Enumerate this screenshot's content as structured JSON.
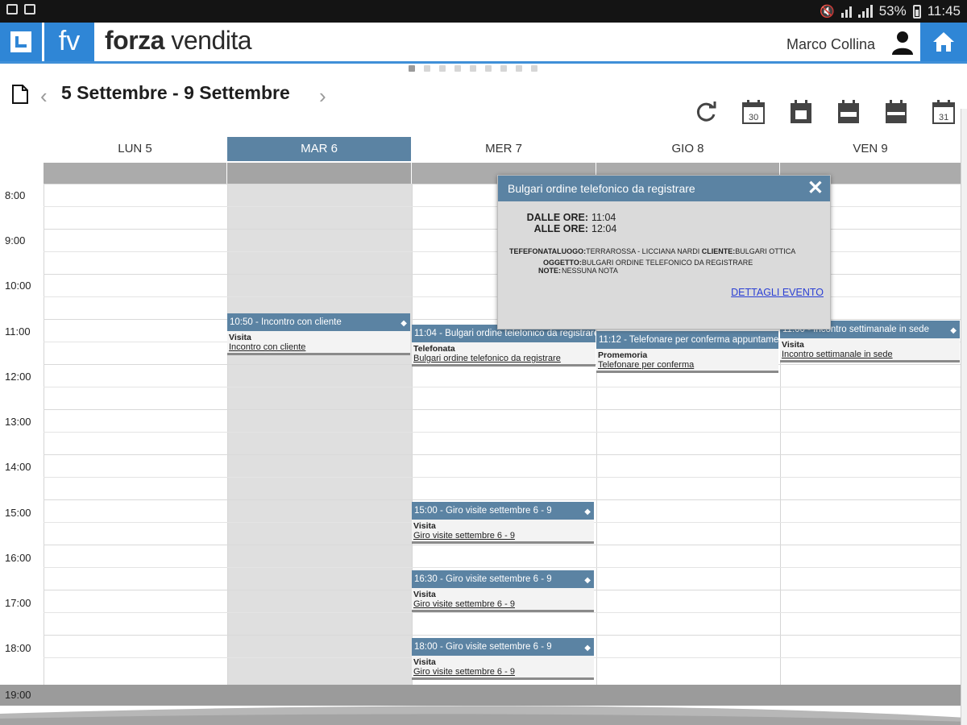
{
  "status_bar": {
    "battery": "53%",
    "time": "11:45"
  },
  "app": {
    "logo_short": "fv",
    "brand_bold": "forza",
    "brand_light": "vendita",
    "user_name": "Marco Collina"
  },
  "nav": {
    "week_title": "5 Settembre - 9 Settembre",
    "prev_arrow": "‹",
    "next_arrow": "›"
  },
  "days": [
    {
      "label": "LUN 5",
      "today": false
    },
    {
      "label": "MAR 6",
      "today": true
    },
    {
      "label": "MER 7",
      "today": false
    },
    {
      "label": "GIO 8",
      "today": false
    },
    {
      "label": "VEN 9",
      "today": false
    }
  ],
  "hours": [
    "8:00",
    "9:00",
    "10:00",
    "11:00",
    "12:00",
    "13:00",
    "14:00",
    "15:00",
    "16:00",
    "17:00",
    "18:00",
    "19:00"
  ],
  "events": [
    {
      "header": "10:50 - Incontro con cliente",
      "type": "Visita",
      "desc": "Incontro con cliente"
    },
    {
      "header": "11:04 - Bulgari ordine telefonico da registrare",
      "type": "Telefonata",
      "desc": "Bulgari ordine telefonico da registrare"
    },
    {
      "header": "11:12 - Telefonare per conferma appuntamento",
      "type": "Promemoria",
      "desc": "Telefonare per conferma"
    },
    {
      "header": "11:00 - Incontro settimanale in sede",
      "type": "Visita",
      "desc": "Incontro settimanale in sede"
    },
    {
      "header": "15:00 - Giro visite settembre 6 - 9",
      "type": "Visita",
      "desc": "Giro visite settembre 6 - 9"
    },
    {
      "header": "16:30 - Giro visite settembre 6 - 9",
      "type": "Visita",
      "desc": "Giro visite settembre 6 - 9"
    },
    {
      "header": "18:00 - Giro visite settembre 6 - 9",
      "type": "Visita",
      "desc": "Giro visite settembre 6 - 9"
    }
  ],
  "popup": {
    "title": "Bulgari ordine telefonico da registrare",
    "close": "✕",
    "from_label": "DALLE ORE:",
    "from_value": "11:04",
    "to_label": "ALLE ORE:",
    "to_value": "12:04",
    "type_value": "TEFEFONATA",
    "place_label": "LUOGO:",
    "place_value": "TERRAROSSA - LICCIANA NARDI",
    "client_label": "CLIENTE:",
    "client_value": "BULGARI OTTICA",
    "subject_label": "OGGETTO:",
    "subject_value": "BULGARI ORDINE TELEFONICO DA REGISTRARE",
    "notes_label": "NOTE:",
    "notes_value": "NESSUNA NOTA",
    "details_link": "DETTAGLI EVENTO"
  },
  "icons": [
    "doc-icon",
    "refresh-icon",
    "calendar-month-icon",
    "calendar-day-icon",
    "calendar-workweek-icon",
    "calendar-week-icon",
    "calendar-31-icon",
    "user-icon",
    "home-icon"
  ],
  "colors": {
    "accent": "#2f86d6",
    "event_header": "#5b83a3",
    "link": "#2b3fd4"
  }
}
